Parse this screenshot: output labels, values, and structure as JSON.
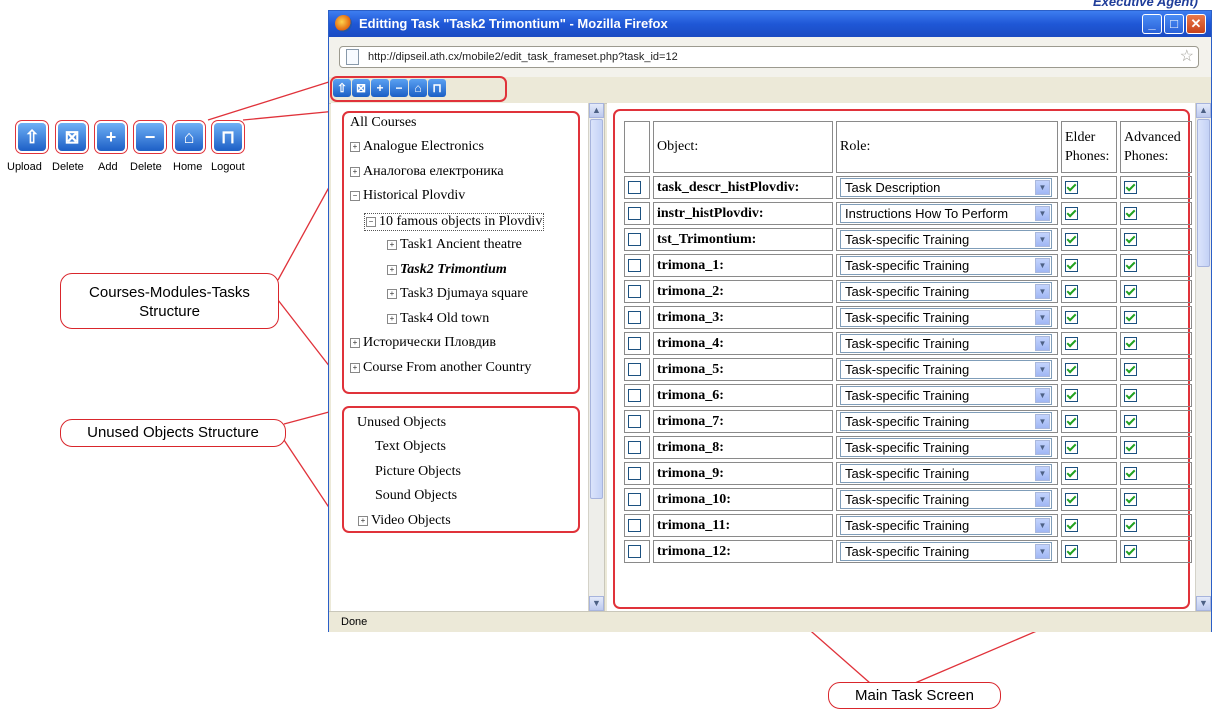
{
  "header_fragment": "Executive Agent)",
  "window": {
    "title": "Editting Task \"Task2 Trimontium\" - Mozilla Firefox",
    "url": "http://dipseil.ath.cx/mobile2/edit_task_frameset.php?task_id=12",
    "status": "Done",
    "min_glyph": "_",
    "max_glyph": "□",
    "close_glyph": "✕"
  },
  "toolbar_icons": [
    "upload-icon",
    "delete-icon",
    "add-icon",
    "remove-icon",
    "home-icon",
    "lock-icon"
  ],
  "legend": {
    "labels": [
      "Upload",
      "Delete",
      "Add",
      "Delete",
      "Home",
      "Logout"
    ]
  },
  "course_tree": {
    "root": "All Courses",
    "items": [
      {
        "label": "Analogue Electronics",
        "toggle": "+"
      },
      {
        "label": "Аналогова електроника",
        "toggle": "+"
      },
      {
        "label": "Historical Plovdiv",
        "toggle": "−"
      },
      {
        "label": "10 famous objects in Plovdiv",
        "toggle": "−"
      },
      {
        "label": "Task1 Ancient theatre",
        "toggle": "+"
      },
      {
        "label": "Task2 Trimontium",
        "toggle": "+"
      },
      {
        "label": "Task3 Djumaya square",
        "toggle": "+"
      },
      {
        "label": "Task4 Old town",
        "toggle": "+"
      },
      {
        "label": "Исторически Пловдив",
        "toggle": "+"
      },
      {
        "label": "Course From another Country",
        "toggle": "+"
      }
    ]
  },
  "unused_tree": {
    "root": "Unused Objects",
    "items": [
      {
        "label": "Text Objects",
        "toggle": ""
      },
      {
        "label": "Picture Objects",
        "toggle": ""
      },
      {
        "label": "Sound Objects",
        "toggle": ""
      },
      {
        "label": "Video Objects",
        "toggle": "+"
      }
    ]
  },
  "table": {
    "headers": {
      "object": "Object:",
      "role": "Role:",
      "elder": "Elder Phones:",
      "advanced": "Advanced Phones:"
    },
    "rows": [
      {
        "object": "task_descr_histPlovdiv:",
        "role": "Task Description"
      },
      {
        "object": "instr_histPlovdiv:",
        "role": "Instructions How To Perform"
      },
      {
        "object": "tst_Trimontium:",
        "role": "Task-specific Training"
      },
      {
        "object": "trimona_1:",
        "role": "Task-specific Training"
      },
      {
        "object": "trimona_2:",
        "role": "Task-specific Training"
      },
      {
        "object": "trimona_3:",
        "role": "Task-specific Training"
      },
      {
        "object": "trimona_4:",
        "role": "Task-specific Training"
      },
      {
        "object": "trimona_5:",
        "role": "Task-specific Training"
      },
      {
        "object": "trimona_6:",
        "role": "Task-specific Training"
      },
      {
        "object": "trimona_7:",
        "role": "Task-specific Training"
      },
      {
        "object": "trimona_8:",
        "role": "Task-specific Training"
      },
      {
        "object": "trimona_9:",
        "role": "Task-specific Training"
      },
      {
        "object": "trimona_10:",
        "role": "Task-specific Training"
      },
      {
        "object": "trimona_11:",
        "role": "Task-specific Training"
      },
      {
        "object": "trimona_12:",
        "role": "Task-specific Training"
      }
    ]
  },
  "callouts": {
    "courses": "Courses-Modules-Tasks Structure",
    "unused": "Unused Objects Structure",
    "main": "Main Task Screen"
  },
  "colors": {
    "callout_red": "#e0323a",
    "titlebar_blue": "#1f57d6"
  }
}
